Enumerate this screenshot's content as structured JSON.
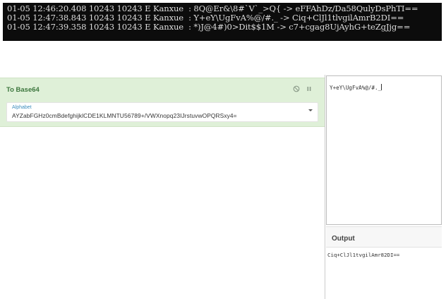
{
  "log": {
    "lines": [
      "01-05 12:46:20.408 10243 10243 E Kanxue  : 8Q@Er&\\8#`V`_>Q{ -> eFFAhDz/Da58QulyDsPhTI==",
      "01-05 12:47:38.843 10243 10243 E Kanxue  : Y+eY\\UgFvA%@/#._ -> Ciq+ClJl1tlvgilAmrB2DI==",
      "01-05 12:47:39.358 10243 10243 E Kanxue  : *)J@4#)0>Dit$$1M -> c7+cgag8UjAyhG+teZgJjg=="
    ]
  },
  "recipe": {
    "operation_title": "To Base64",
    "disable_icon": "disable-icon",
    "pause_icon": "pause-icon",
    "alphabet_label": "Alphabet",
    "alphabet_value": "AYZabFGHz0cmBdefghijklCDE1KLMNTU56789+/VWXnopq23IJrstuvwOPQRSxy4="
  },
  "input": {
    "value": "Y+eY\\UgFvA%@/#._"
  },
  "output": {
    "title": "Output",
    "value": "Ciq+ClJl1tvgilAmr82DI=="
  },
  "colors": {
    "operation_bg": "#dff0d8",
    "operation_title": "#3c763d",
    "terminal_bg": "#0c0c0c"
  }
}
